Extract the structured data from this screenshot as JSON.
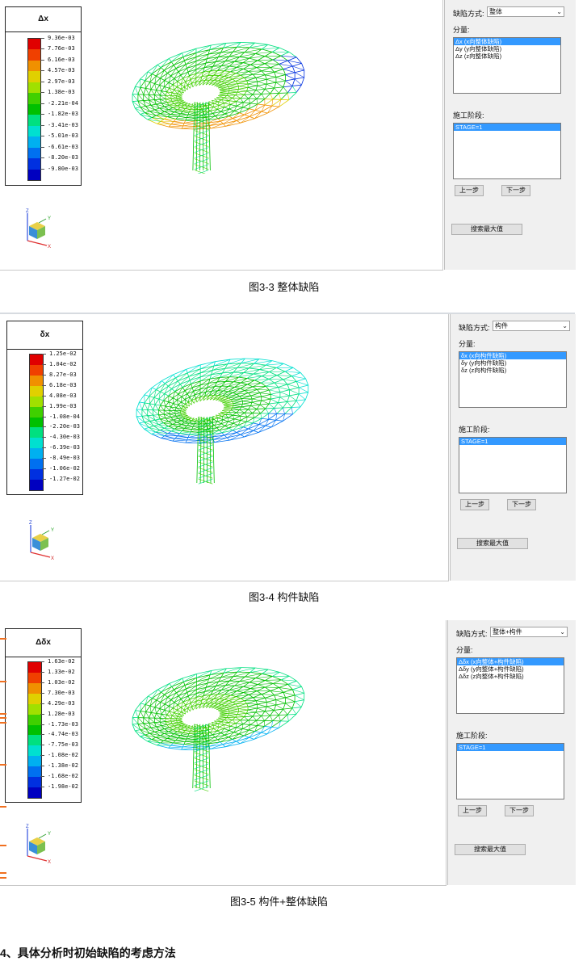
{
  "figures": [
    {
      "id": "fig-3-3",
      "legend": {
        "title": "Δx",
        "ticks": [
          "9.36e-03",
          "7.76e-03",
          "6.16e-03",
          "4.57e-03",
          "2.97e-03",
          "1.38e-03",
          "-2.21e-04",
          "-1.82e-03",
          "-3.41e-03",
          "-5.01e-03",
          "-6.61e-03",
          "-8.20e-03",
          "-9.80e-03"
        ]
      },
      "panel": {
        "mode_label": "缺陷方式:",
        "mode_value": "整体",
        "component_label": "分量:",
        "components": [
          "Δx (x向整体缺陷)",
          "Δy (y向整体缺陷)",
          "Δz (z向整体缺陷)"
        ],
        "selected_component": 0,
        "stage_label": "施工阶段:",
        "stages": [
          "STAGE=1"
        ],
        "prev_label": "上一步",
        "next_label": "下一步",
        "search_label": "搜索最大值"
      },
      "axes": {
        "z": "Z",
        "y": "Y",
        "x": "X"
      },
      "caption": "图3-3  整体缺陷"
    },
    {
      "id": "fig-3-4",
      "legend": {
        "title": "δx",
        "ticks": [
          "1.25e-02",
          "1.04e-02",
          "8.27e-03",
          "6.18e-03",
          "4.08e-03",
          "1.99e-03",
          "-1.08e-04",
          "-2.20e-03",
          "-4.30e-03",
          "-6.39e-03",
          "-8.49e-03",
          "-1.06e-02",
          "-1.27e-02"
        ]
      },
      "panel": {
        "mode_label": "缺陷方式:",
        "mode_value": "构件",
        "component_label": "分量:",
        "components": [
          "δx (x向构件缺陷)",
          "δy (y向构件缺陷)",
          "δz (z向构件缺陷)"
        ],
        "selected_component": 0,
        "stage_label": "施工阶段:",
        "stages": [
          "STAGE=1"
        ],
        "prev_label": "上一步",
        "next_label": "下一步",
        "search_label": "搜索最大值"
      },
      "axes": {
        "z": "Z",
        "y": "Y",
        "x": "X"
      },
      "caption": "图3-4  构件缺陷"
    },
    {
      "id": "fig-3-5",
      "legend": {
        "title": "Δδx",
        "ticks": [
          "1.63e-02",
          "1.33e-02",
          "1.03e-02",
          "7.30e-03",
          "4.29e-03",
          "1.28e-03",
          "-1.73e-03",
          "-4.74e-03",
          "-7.75e-03",
          "-1.08e-02",
          "-1.38e-02",
          "-1.68e-02",
          "-1.98e-02"
        ]
      },
      "panel": {
        "mode_label": "缺陷方式:",
        "mode_value": "整体+构件",
        "component_label": "分量:",
        "components": [
          "Δδx (x向整体+构件缺陷)",
          "Δδy (y向整体+构件缺陷)",
          "Δδz (z向整体+构件缺陷)"
        ],
        "selected_component": 0,
        "stage_label": "施工阶段:",
        "stages": [
          "STAGE=1"
        ],
        "prev_label": "上一步",
        "next_label": "下一步",
        "search_label": "搜索最大值"
      },
      "axes": {
        "z": "Z",
        "y": "Y",
        "x": "X"
      },
      "caption": "图3-5  构件+整体缺陷"
    }
  ],
  "colors": {
    "scale": [
      "#e00000",
      "#f04000",
      "#f09000",
      "#e0d000",
      "#a0e000",
      "#40d000",
      "#00c000",
      "#00e080",
      "#00e0d0",
      "#00b0f0",
      "#0070f0",
      "#0030e0",
      "#0000c0"
    ],
    "selection": "#3399ff",
    "accent_marks": "#f07020"
  },
  "section_heading": "4、具体分析时初始缺陷的考虑方法"
}
